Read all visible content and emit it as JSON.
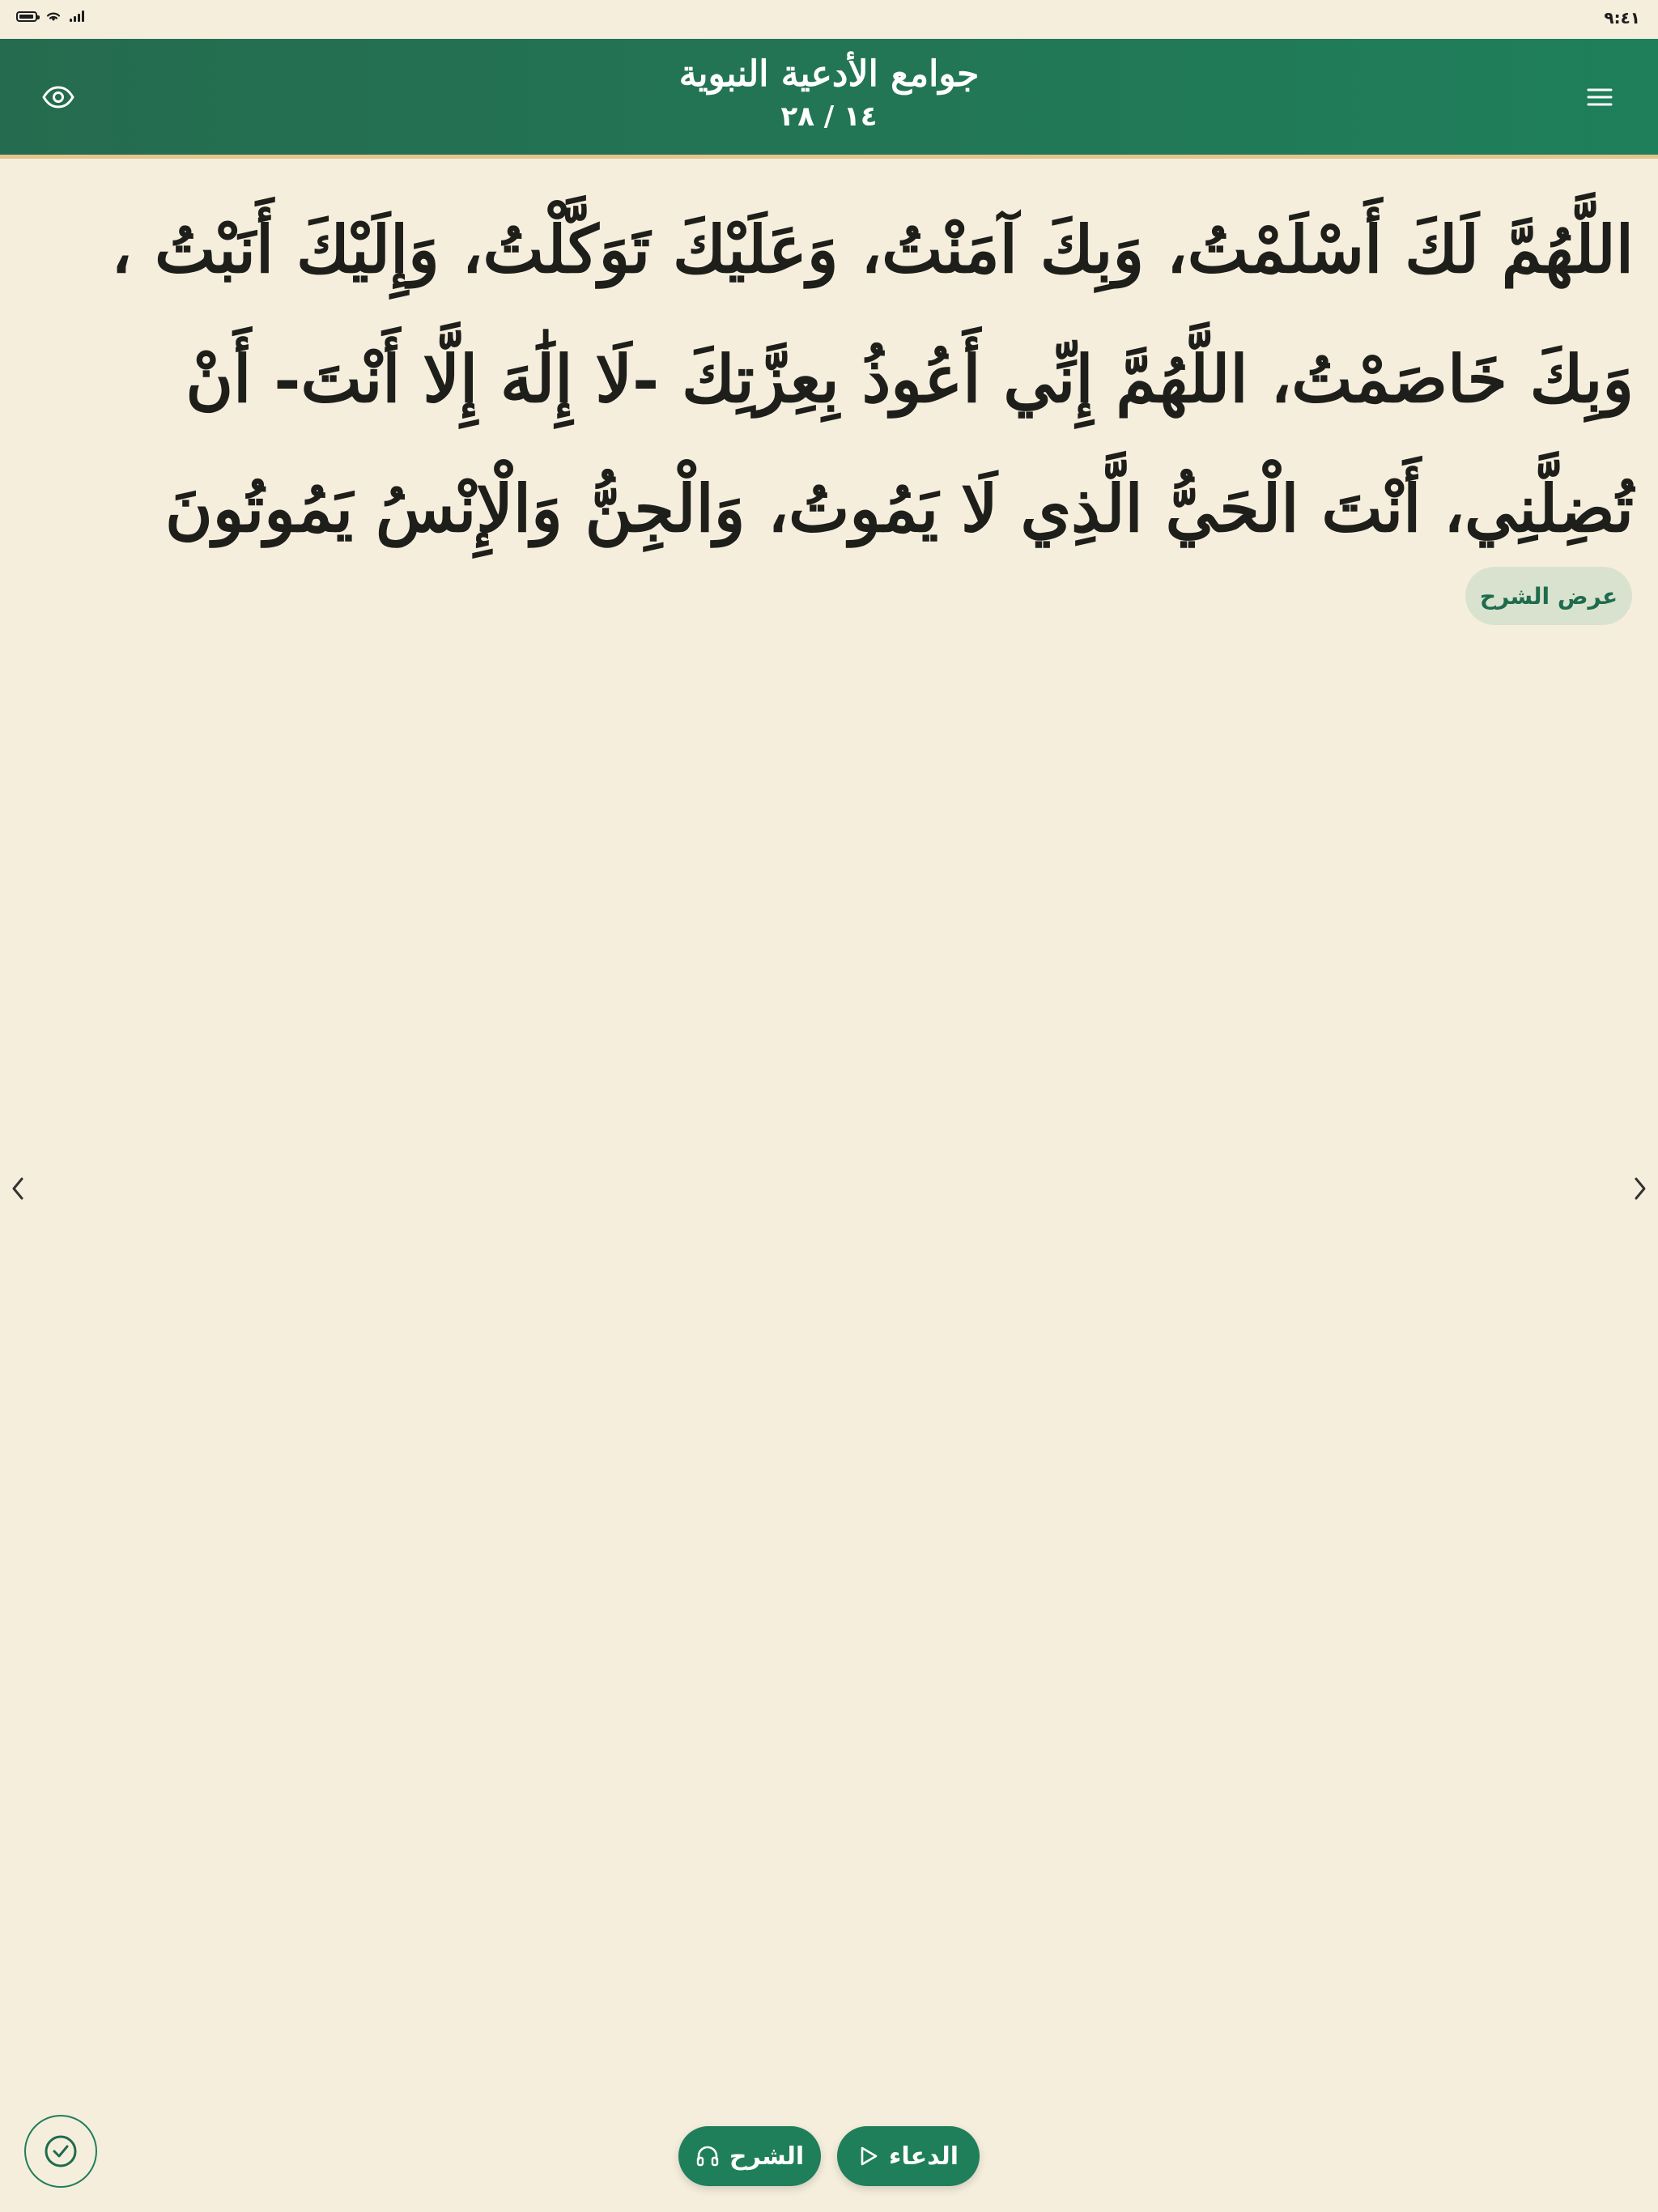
{
  "status_bar": {
    "time": "٩:٤١"
  },
  "header": {
    "title": "جوامع الأدعية النبوية",
    "counter": "١٤ / ٢٨"
  },
  "dua": {
    "text": "اللَّهُمَّ لَكَ أَسْلَمْتُ، وَبِكَ آمَنْتُ، وَعَلَيْكَ تَوَكَّلْتُ، وَإِلَيْكَ أَنَبْتُ ، وَبِكَ خَاصَمْتُ، اللَّهُمَّ إِنِّي أَعُوذُ بِعِزَّتِكَ -لَا إِلَٰهَ إِلَّا أَنْتَ- أَنْ تُضِلَّنِي، أَنْتَ الْحَيُّ الَّذِي لَا يَمُوتُ، وَالْجِنُّ وَالْإِنْسُ يَمُوتُونَ"
  },
  "actions": {
    "show_explanation": "عرض الشرح",
    "play_explanation": "الشرح",
    "play_dua": "الدعاء"
  },
  "icons": {
    "eye": "eye-icon",
    "menu": "menu-icon",
    "headphones": "headphones-icon",
    "play": "play-icon",
    "check": "check-circle-icon",
    "prev": "chevron-left-icon",
    "next": "chevron-right-icon"
  },
  "colors": {
    "primary": "#1f7f5b",
    "header_dark": "#256b4f",
    "background": "#f6eedc",
    "accent_line": "#e6c58c",
    "text": "#1e1f1b",
    "chip_bg": "#d9e2cf"
  }
}
